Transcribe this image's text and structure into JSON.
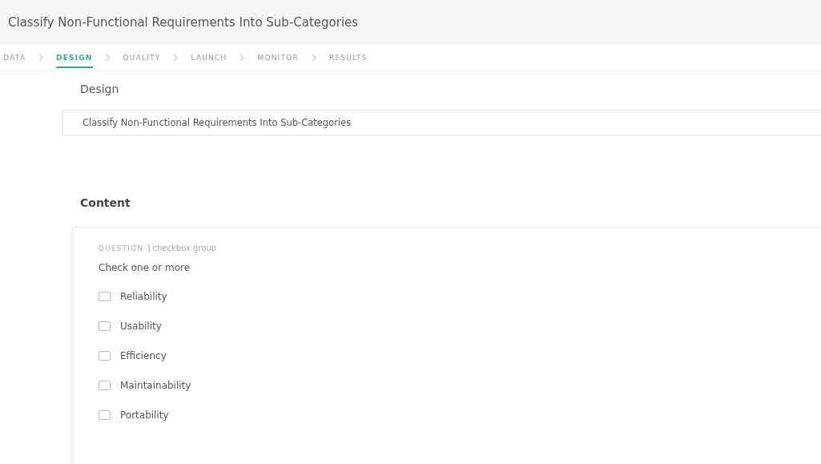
{
  "header": {
    "title": "Classify Non-Functional Requirements Into Sub-Categories"
  },
  "steps": [
    {
      "label": "DATA",
      "selected": false
    },
    {
      "label": "DESIGN",
      "selected": true
    },
    {
      "label": "QUALITY",
      "selected": false
    },
    {
      "label": "LAUNCH",
      "selected": false
    },
    {
      "label": "MONITOR",
      "selected": false
    },
    {
      "label": "RESULTS",
      "selected": false
    }
  ],
  "design": {
    "label": "Design",
    "value": "Classify Non-Functional Requirements Into Sub-Categories"
  },
  "content": {
    "heading": "Content",
    "question": {
      "tag": "QUESTION",
      "type": "] checkbox group",
      "prompt": "Check one or more",
      "options": [
        {
          "label": "Reliability",
          "checked": false
        },
        {
          "label": "Usability",
          "checked": false
        },
        {
          "label": "Efficiency",
          "checked": false
        },
        {
          "label": "Maintainability",
          "checked": false
        },
        {
          "label": "Portability",
          "checked": false
        }
      ]
    }
  }
}
